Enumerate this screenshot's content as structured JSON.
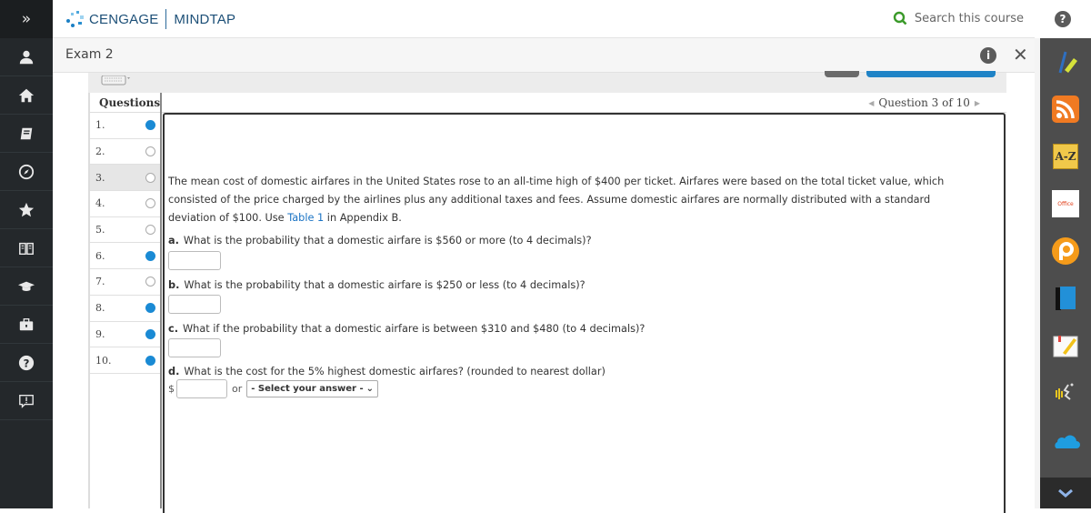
{
  "leftnav": {
    "expand_label": "»",
    "items": [
      {
        "icon": "user-icon"
      },
      {
        "icon": "home-icon"
      },
      {
        "icon": "book-icon"
      },
      {
        "icon": "compass-icon"
      },
      {
        "icon": "star-icon"
      },
      {
        "icon": "open-book-icon"
      },
      {
        "icon": "graduation-cap-icon"
      },
      {
        "icon": "briefcase-icon"
      },
      {
        "icon": "help-icon"
      },
      {
        "icon": "feedback-icon"
      }
    ]
  },
  "topbar": {
    "brand": "CENGAGE",
    "product": "MINDTAP",
    "search_label": "Search this course",
    "help_label": "?"
  },
  "exam": {
    "title": "Exam 2",
    "info_label": "i",
    "close_label": "✕"
  },
  "questions": {
    "header": "Questions",
    "items": [
      {
        "label": "1.",
        "answered": true
      },
      {
        "label": "2.",
        "answered": false
      },
      {
        "label": "3.",
        "answered": false,
        "active": true
      },
      {
        "label": "4.",
        "answered": false
      },
      {
        "label": "5.",
        "answered": false
      },
      {
        "label": "6.",
        "answered": true
      },
      {
        "label": "7.",
        "answered": false
      },
      {
        "label": "8.",
        "answered": true
      },
      {
        "label": "9.",
        "answered": true
      },
      {
        "label": "10.",
        "answered": true
      }
    ],
    "nav_label": "Question 3 of 10",
    "prev_arrow": "◀",
    "next_arrow": "▶"
  },
  "problem": {
    "text_before_link": "The mean cost of domestic airfares in the United States rose to an all-time high of $400 per ticket. Airfares were based on the total ticket value, which consisted of the price charged by the airlines plus any additional taxes and fees. Assume domestic airfares are normally distributed with a standard deviation of $100. Use ",
    "link_text": "Table 1",
    "text_after_link": " in Appendix B.",
    "parts": [
      {
        "letter": "a.",
        "text": "What is the probability that a domestic airfare is $560 or more (to 4 decimals)?",
        "value": ""
      },
      {
        "letter": "b.",
        "text": "What is the probability that a domestic airfare is $250 or less (to 4 decimals)?",
        "value": ""
      },
      {
        "letter": "c.",
        "text": "What if the probability that a domestic airfare is between $310 and $480 (to 4 decimals)?",
        "value": ""
      },
      {
        "letter": "d.",
        "text": "What is the cost for the 5% highest domestic airfares? (rounded to nearest dollar)",
        "value": ""
      }
    ],
    "d_currency": "$",
    "d_or": "or",
    "d_select": "- Select your answer -"
  },
  "rightbar": {
    "tools": [
      "highlighter-icon",
      "rss-icon",
      "glossary-az-icon",
      "office-icon",
      "pearson-icon",
      "ebook-icon",
      "notes-icon",
      "read-aloud-icon",
      "onedrive-icon",
      "google-drive-icon"
    ],
    "glossary_label": "A-Z",
    "office_label": "Office",
    "more_icon": "chevron-down-icon"
  }
}
